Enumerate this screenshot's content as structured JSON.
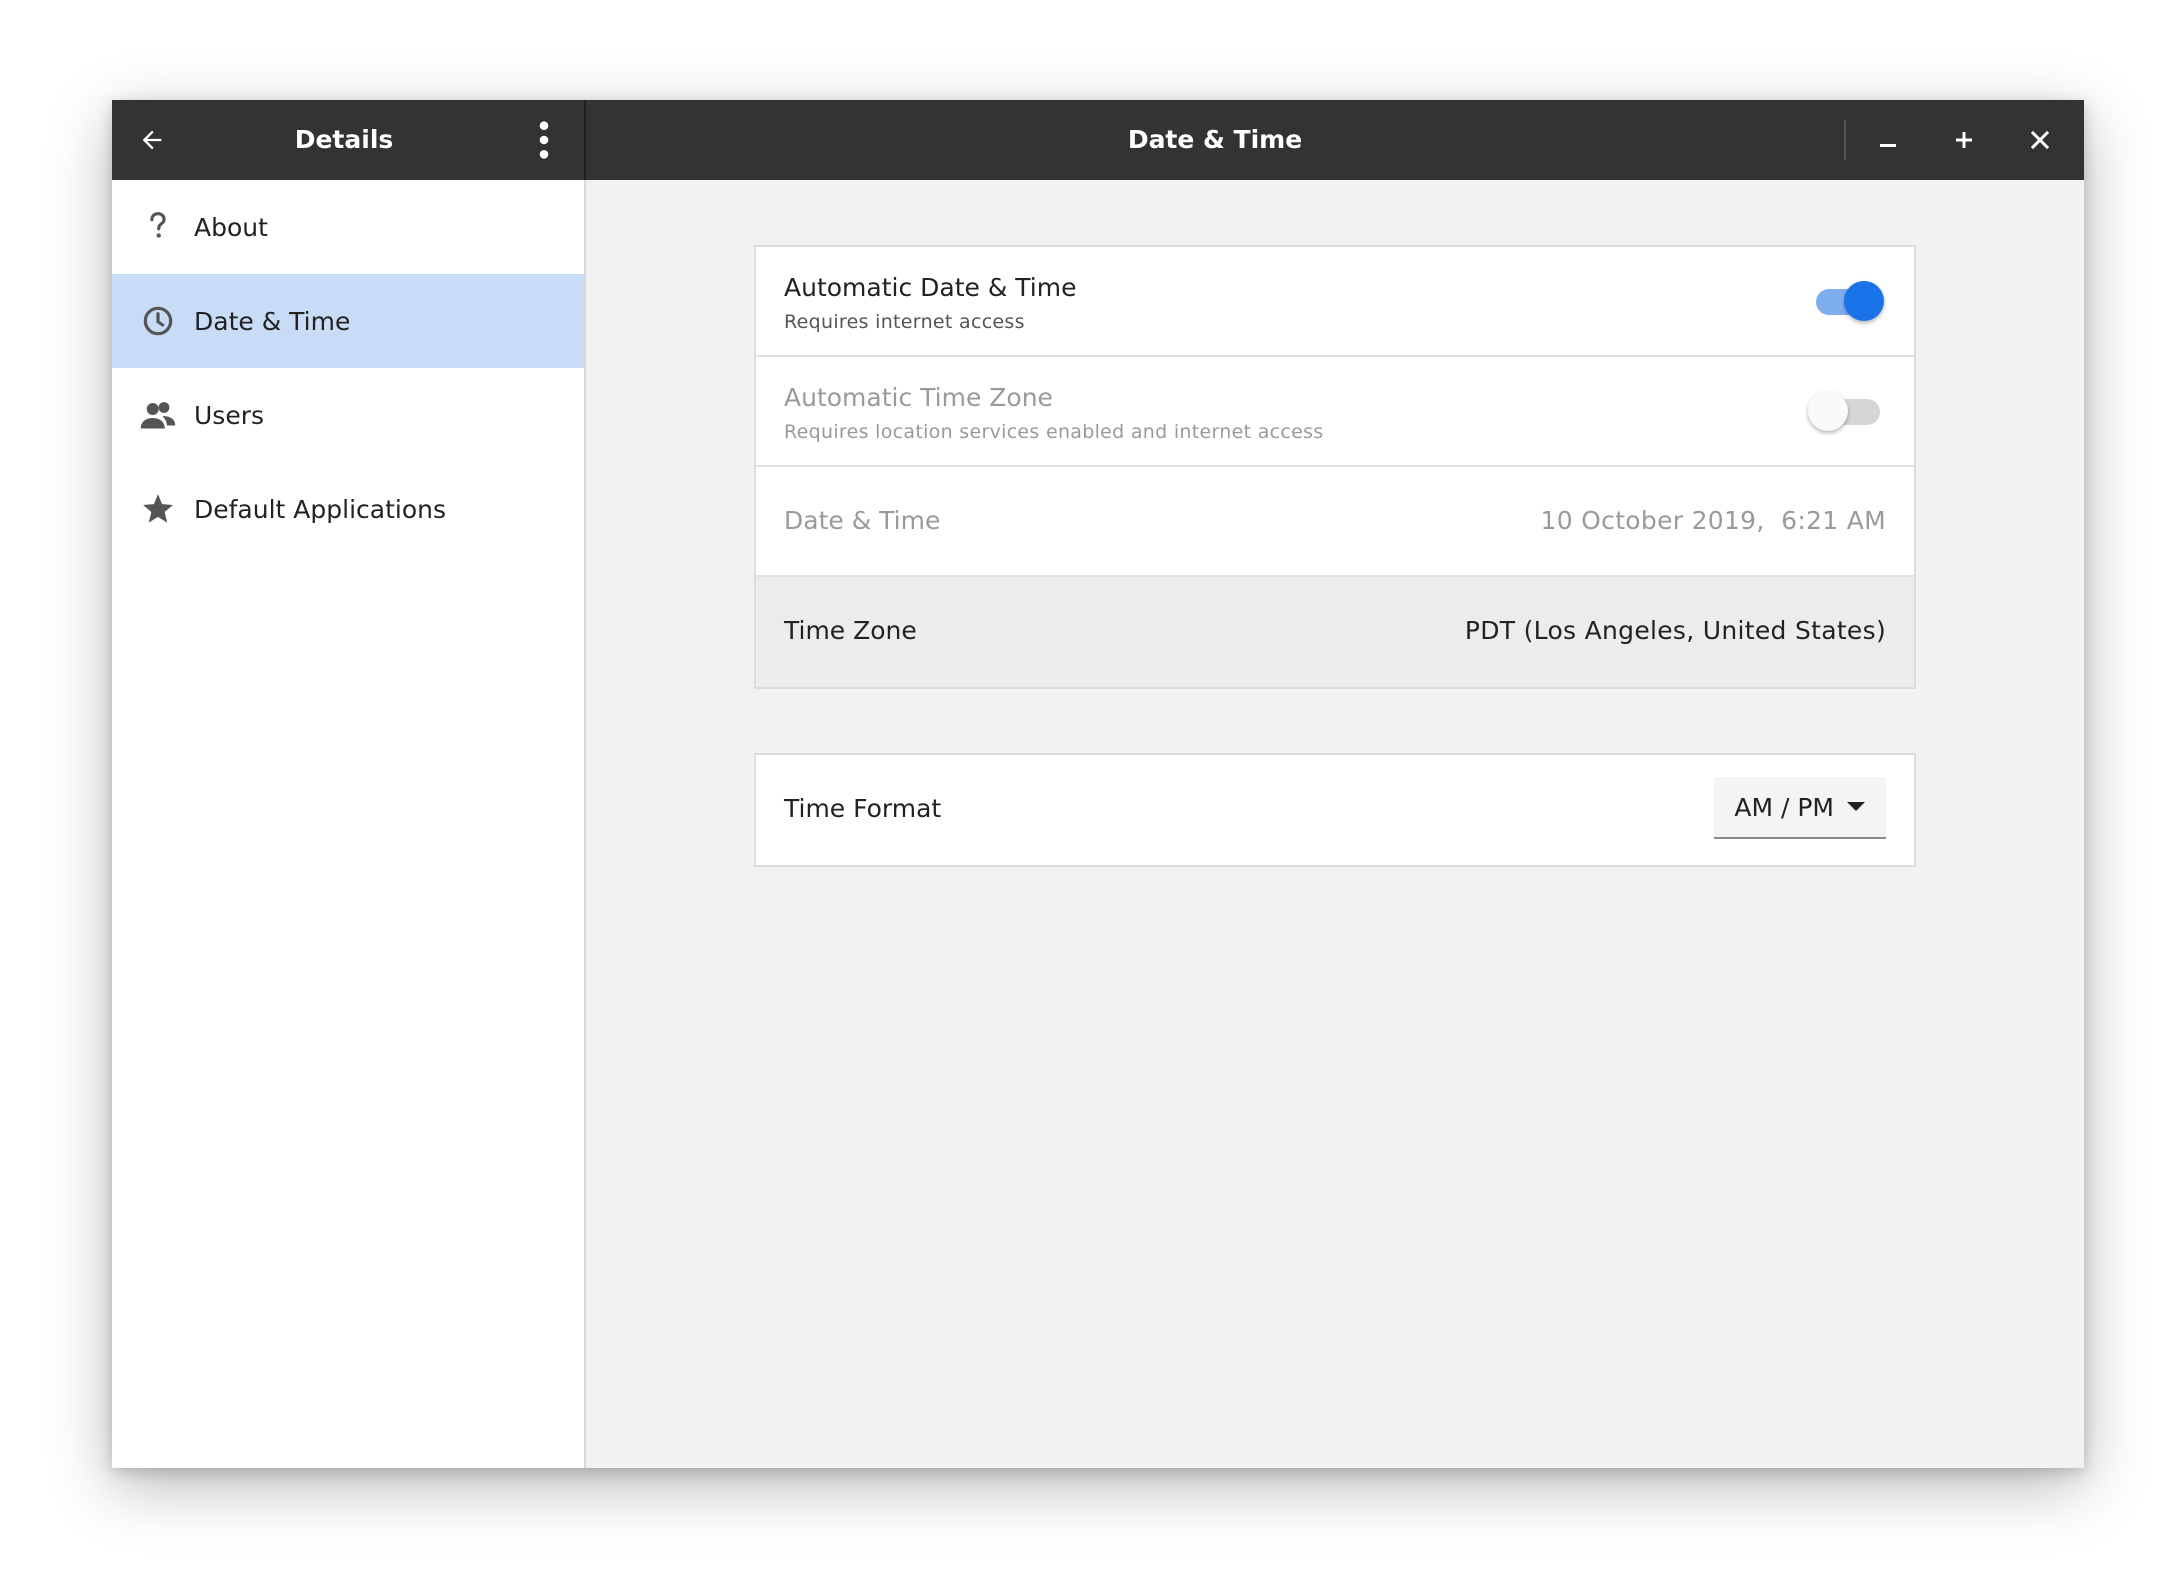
{
  "colors": {
    "titlebar": "#333333",
    "accent": "#1a73e8",
    "accent_track": "#7faef0",
    "selected_bg": "#c9dcf7",
    "toggle_off_track": "#cfcfcf",
    "toggle_off_knob": "#fafafa"
  },
  "titlebar": {
    "left_title": "Details",
    "main_title": "Date & Time",
    "back_icon": "arrow-left-icon",
    "menu_icon": "more-vert-icon",
    "window_controls": [
      "minimize-icon",
      "maximize-icon",
      "close-icon"
    ]
  },
  "sidebar": {
    "items": [
      {
        "label": "About",
        "icon": "help-icon",
        "selected": false
      },
      {
        "label": "Date & Time",
        "icon": "clock-icon",
        "selected": true
      },
      {
        "label": "Users",
        "icon": "people-icon",
        "selected": false
      },
      {
        "label": "Default Applications",
        "icon": "star-icon",
        "selected": false
      }
    ]
  },
  "settings": {
    "auto_datetime": {
      "title": "Automatic Date & Time",
      "subtitle": "Requires internet access",
      "enabled": true
    },
    "auto_timezone": {
      "title": "Automatic Time Zone",
      "subtitle": "Requires location services enabled and internet access",
      "enabled": false
    },
    "datetime": {
      "title": "Date & Time",
      "value": "10 October 2019,  6:21 AM"
    },
    "timezone": {
      "title": "Time Zone",
      "value": "PDT (Los Angeles, United States)"
    },
    "time_format": {
      "title": "Time Format",
      "value": "AM / PM"
    }
  }
}
